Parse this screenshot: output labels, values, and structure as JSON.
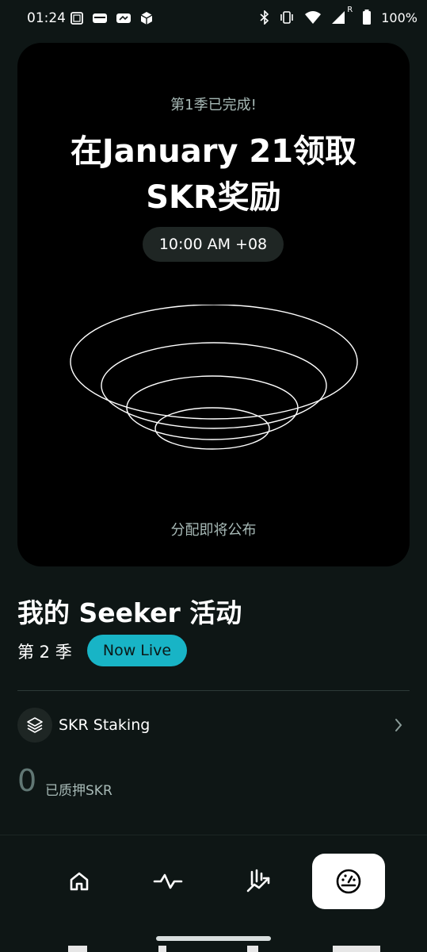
{
  "status_bar": {
    "time": "01:24",
    "battery": "100%",
    "roaming": "R"
  },
  "season_card": {
    "status": "第1季已完成!",
    "claim_title": "在January 21领取SKR奖励",
    "claim_time": "10:00 AM +08",
    "distribution_note": "分配即将公布"
  },
  "activity": {
    "title": "我的 Seeker 活动",
    "season_label": "第 2 季",
    "live_badge": "Now Live"
  },
  "staking": {
    "label": "SKR Staking",
    "amount": "0",
    "amount_label": "已质押SKR"
  },
  "nav": {
    "items": [
      {
        "icon": "home-icon",
        "active": false
      },
      {
        "icon": "activity-icon",
        "active": false
      },
      {
        "icon": "trends-icon",
        "active": false
      },
      {
        "icon": "dashboard-icon",
        "active": true
      }
    ]
  },
  "colors": {
    "background": "#0e1615",
    "card": "#000000",
    "accent": "#18b4c6",
    "muted": "#a7b9b6"
  }
}
